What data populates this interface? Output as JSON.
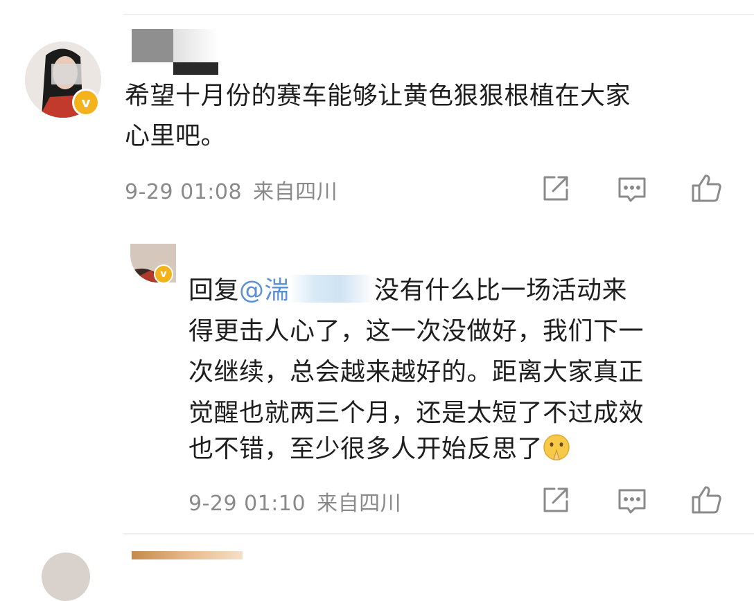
{
  "comment": {
    "text_line1": "希望十月份的赛车能够让黄色狠狠根植在大家",
    "text_line2": "心里吧。",
    "time": "9-29 01:08",
    "location": "来自四川",
    "verified_mark": "v",
    "icons": [
      "share-icon",
      "comment-icon",
      "like-icon"
    ]
  },
  "reply": {
    "prefix": "回复",
    "mention_visible": "@湍",
    "line1_rest": "没有什么比一场活动来",
    "line2": "得更击人心了，这一次没做好，我们下一",
    "line3": "次继续，总会越来越好的。距离大家真正",
    "line4": "觉醒也就两三个月，还是太短了不过成效",
    "line5": "也不错，至少很多人开始反思了",
    "emoji": "praying-face-emoji",
    "time": "9-29 01:10",
    "location": "来自四川",
    "verified_mark": "v",
    "icons": [
      "share-icon",
      "comment-icon",
      "like-icon"
    ]
  },
  "colors": {
    "text": "#1e1e1e",
    "meta": "#8a8a8a",
    "mention": "#5b8fd6",
    "badge": "#f5b31b",
    "divider": "#efefef"
  }
}
